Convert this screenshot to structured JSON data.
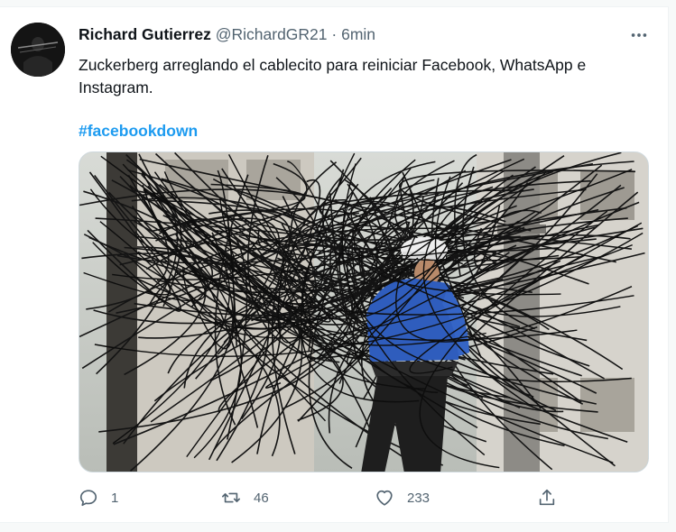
{
  "tweet": {
    "author_name": "Richard Gutierrez",
    "author_handle": "@RichardGR21",
    "separator": "·",
    "time": "6min",
    "text": "Zuckerberg arreglando el cablecito para reiniciar Facebook, WhatsApp e Instagram.",
    "hashtag": "#facebookdown",
    "icons": {
      "more": "more-horizontal-icon",
      "reply": "reply-icon",
      "retweet": "retweet-icon",
      "like": "heart-icon",
      "share": "share-icon"
    },
    "stats": {
      "replies": "1",
      "retweets": "46",
      "likes": "233"
    },
    "colors": {
      "link": "#1d9bf0",
      "secondary_text": "#536471",
      "primary_text": "#0f1419"
    }
  }
}
